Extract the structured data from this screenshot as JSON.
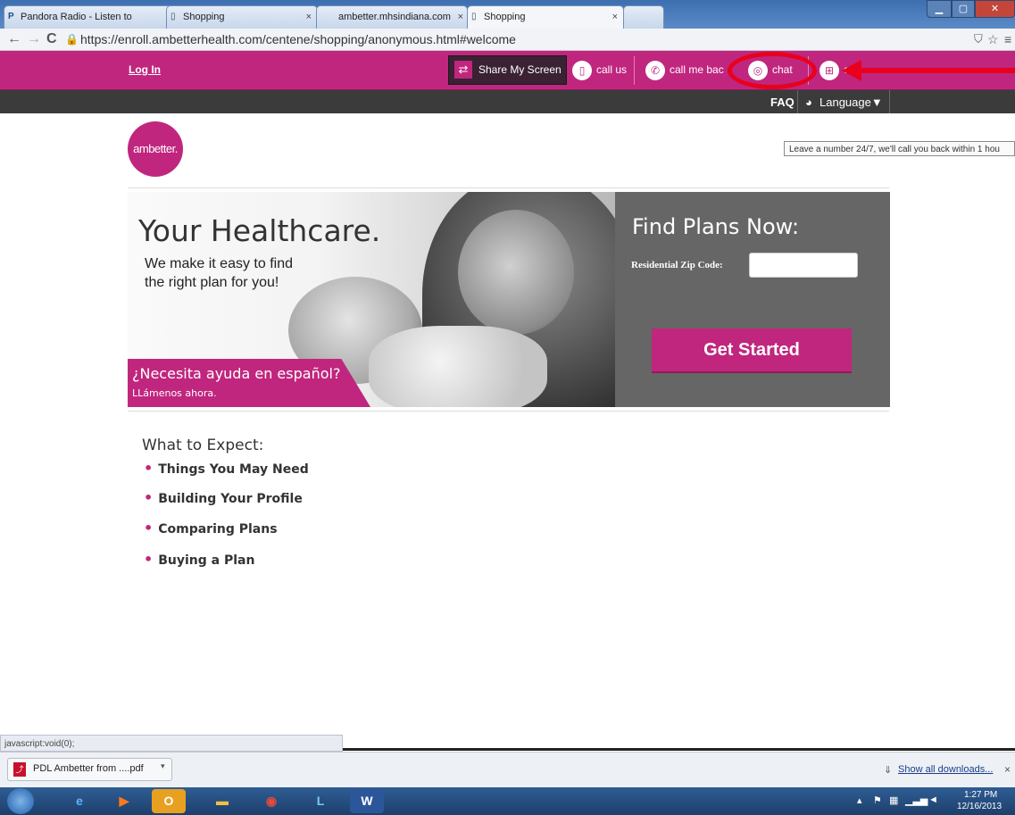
{
  "browser": {
    "tabs": [
      {
        "label": "Pandora Radio - Listen to",
        "icon": "pandora-icon",
        "close": "×"
      },
      {
        "label": "Shopping",
        "icon": "page-icon",
        "close": "×"
      },
      {
        "label": "ambetter.mhsindiana.com",
        "icon": "page-icon",
        "close": "×"
      },
      {
        "label": "Shopping",
        "icon": "page-icon",
        "close": "×"
      }
    ],
    "url": "https://enroll.ambetterhealth.com/centene/shopping/anonymous.html#welcome",
    "status_text": "javascript:void(0);"
  },
  "site_header": {
    "login_label": "Log In",
    "share_screen_label": "Share My Screen",
    "call_us_label": "call us",
    "call_me_back_label": "call me bac",
    "chat_label": "chat",
    "cart_label": "c",
    "faq_label": "FAQ",
    "language_label": "Language▼",
    "tooltip": "Leave a number 24/7, we'll call you back within 1 hou"
  },
  "logo_text": "ambetter.",
  "hero": {
    "title": "Your Healthcare.",
    "subtitle_line1": "We make it easy to find",
    "subtitle_line2": "the right plan for you!",
    "spanish_title": "¿Necesita ayuda en español?",
    "spanish_sub": "LLámenos ahora."
  },
  "find_plans": {
    "title": "Find Plans Now:",
    "zip_label": "Residential Zip Code:",
    "zip_value": "",
    "button_label": "Get Started"
  },
  "expect": {
    "heading": "What to Expect:",
    "items": [
      "Things You May Need",
      "Building Your Profile",
      "Comparing Plans",
      "Buying a Plan"
    ]
  },
  "downloads_bar": {
    "file_name": "PDL Ambetter from ....pdf",
    "show_all": "Show all downloads...",
    "close": "×"
  },
  "taskbar": {
    "time": "1:27 PM",
    "date": "12/16/2013"
  },
  "colors": {
    "brand_magenta": "#c0267e",
    "annotation_red": "#e8001c"
  }
}
